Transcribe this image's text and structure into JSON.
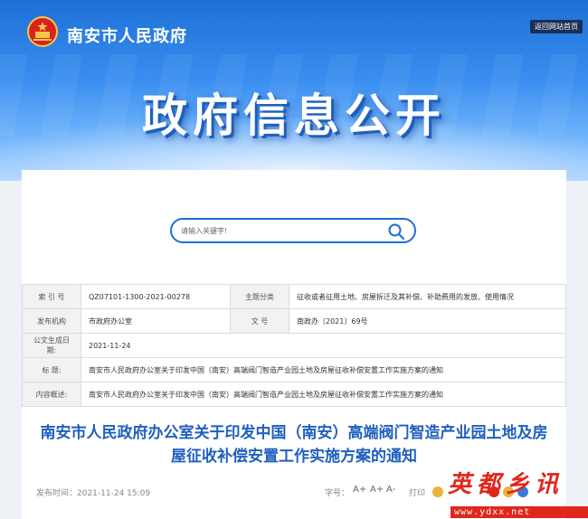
{
  "header": {
    "site_name": "南安市人民政府",
    "back_home": "返回网站首页",
    "hero_title": "政府信息公开"
  },
  "search": {
    "placeholder": "请输入关键字!"
  },
  "meta": {
    "index_label": "索 引 号",
    "index_value": "QZ07101-1300-2021-00278",
    "category_label": "主题分类",
    "category_value": "征收或者征用土地、房屋拆迁及其补偿、补助费用的发放、使用情况",
    "org_label": "发布机构",
    "org_value": "市政府办公室",
    "docno_label": "文    号",
    "docno_value": "南政办〔2021〕69号",
    "date_label": "公文生成日期:",
    "date_value": "2021-11-24",
    "title_label": "标    题:",
    "title_value": "南安市人民政府办公室关于印发中国（南安）高端阀门智造产业园土地及房屋征收补偿安置工作实施方案的通知",
    "summary_label": "内容概述:",
    "summary_value": "南安市人民政府办公室关于印发中国（南安）高端阀门智造产业园土地及房屋征收补偿安置工作实施方案的通知"
  },
  "article": {
    "title_line1": "南安市人民政府办公室关于印发中国（南安）高端阀门智造产业园土地及房",
    "title_line2": "屋征收补偿安置工作实施方案的通知",
    "publish_time": "发布时间：2021-11-24 15:09",
    "font_size_label": "字号：",
    "font_large": "A+",
    "font_medium": "A+",
    "font_small": "A-",
    "print_label": "打印"
  },
  "watermark": {
    "text": "英都乡讯",
    "url": "www.ydxx.net"
  },
  "colors": {
    "brand_blue": "#1f5fbf",
    "watermark_red": "#e1261c"
  }
}
